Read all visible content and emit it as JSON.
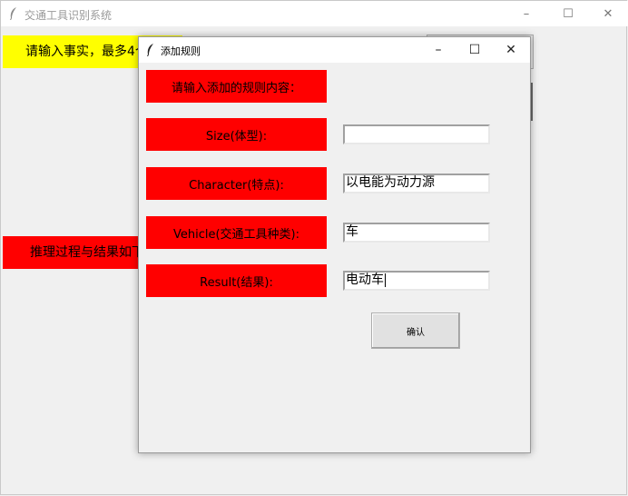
{
  "main": {
    "title": "交通工具识别系统",
    "minimize": "–",
    "maximize": "☐",
    "close": "✕",
    "facts_prompt": "请输入事实，最多4个",
    "result_label": "推理过程与结果如下"
  },
  "dialog": {
    "title": "添加规则",
    "minimize": "–",
    "maximize": "☐",
    "close": "✕",
    "header": "请输入添加的规则内容：",
    "fields": {
      "size_label": "Size(体型):",
      "size_value": "",
      "character_label": "Character(特点):",
      "character_value": "以电能为动力源",
      "vehicle_label": "Vehicle(交通工具种类):",
      "vehicle_value": "车",
      "result_label": "Result(结果):",
      "result_value": "电动车"
    },
    "confirm_label": "确认"
  },
  "colors": {
    "red": "#ff0000",
    "yellow": "#ffff00",
    "window_bg": "#f0f0f0"
  },
  "icons": {
    "app": "feather-icon"
  }
}
